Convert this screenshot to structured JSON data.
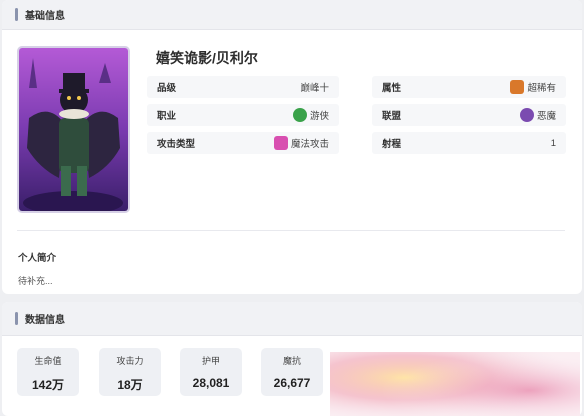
{
  "basic_section": {
    "title": "基础信息"
  },
  "hero": {
    "name": "嬉笑诡影/贝利尔",
    "attributes": {
      "grade": {
        "label": "品级",
        "value": "巅峰十"
      },
      "rarity": {
        "label": "属性",
        "value": "超稀有",
        "icon": "rarity-icon",
        "icon_color": "#d9782b"
      },
      "profession": {
        "label": "职业",
        "value": "游侠",
        "icon": "ranger-icon",
        "icon_color": "#3aa24a"
      },
      "alliance": {
        "label": "联盟",
        "value": "恶魔",
        "icon": "demon-icon",
        "icon_color": "#7b4bb0"
      },
      "attack_type": {
        "label": "攻击类型",
        "value": "魔法攻击",
        "icon": "magic-attack-icon",
        "icon_color": "#d84fb0"
      },
      "range": {
        "label": "射程",
        "value": "1"
      }
    },
    "intro": {
      "title": "个人简介",
      "text": "待补充..."
    }
  },
  "data_section": {
    "title": "数据信息",
    "stats": [
      {
        "label": "生命值",
        "value": "142万"
      },
      {
        "label": "攻击力",
        "value": "18万"
      },
      {
        "label": "护甲",
        "value": "28,081"
      },
      {
        "label": "魔抗",
        "value": "26,677"
      }
    ]
  },
  "colors": {
    "accent_bar": "#8a93ad",
    "card_bg": "#ffffff",
    "page_bg": "#eeeff2"
  }
}
